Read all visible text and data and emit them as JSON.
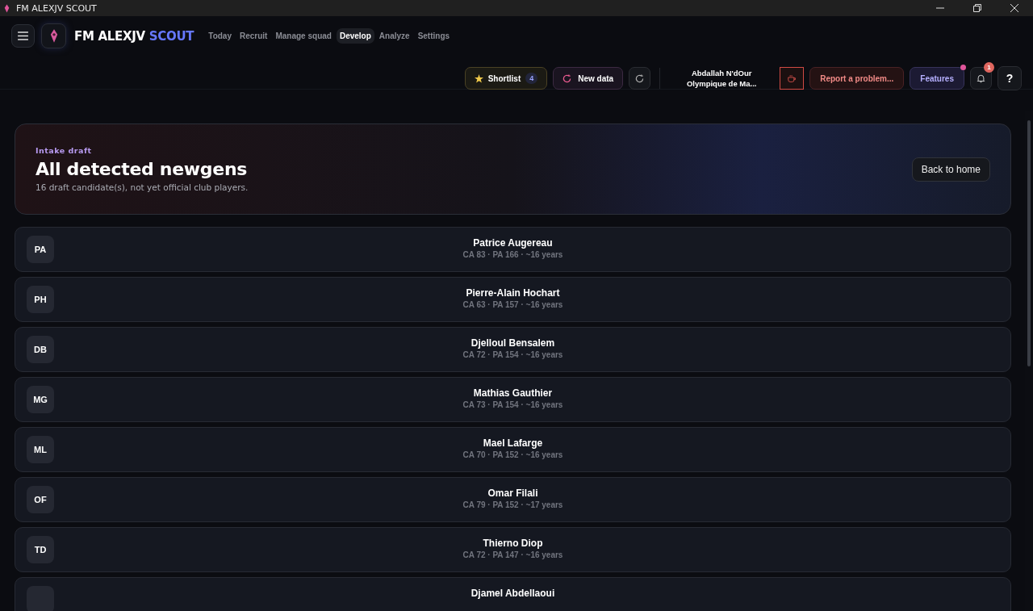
{
  "window": {
    "title": "FM ALEXJV SCOUT"
  },
  "brand": {
    "name": "FM ALEXJV",
    "accent": "SCOUT"
  },
  "nav": [
    {
      "label": "Today",
      "selected": false
    },
    {
      "label": "Recruit",
      "selected": false
    },
    {
      "label": "Manage squad",
      "selected": false
    },
    {
      "label": "Develop",
      "selected": true
    },
    {
      "label": "Analyze",
      "selected": false
    },
    {
      "label": "Settings",
      "selected": false
    }
  ],
  "toolbar": {
    "shortlist": {
      "label": "Shortlist",
      "count": "4"
    },
    "new_data": "New data",
    "manager": {
      "name": "Abdallah N'dOur",
      "club": "Olympique de Ma..."
    },
    "report": "Report a problem...",
    "features": {
      "label": "Features",
      "new_dot": true
    },
    "notifications": {
      "count": "1"
    },
    "help": "?"
  },
  "hero": {
    "eyebrow": "Intake draft",
    "title": "All detected newgens",
    "subtitle": "16 draft candidate(s), not yet official club players.",
    "button": "Back to home"
  },
  "players": [
    {
      "initials": "PA",
      "name": "Patrice Augereau",
      "meta": "CA 83 · PA 166 · ~16 years"
    },
    {
      "initials": "PH",
      "name": "Pierre-Alain Hochart",
      "meta": "CA 63 · PA 157 · ~16 years"
    },
    {
      "initials": "DB",
      "name": "Djelloul Bensalem",
      "meta": "CA 72 · PA 154 · ~16 years"
    },
    {
      "initials": "MG",
      "name": "Mathias Gauthier",
      "meta": "CA 73 · PA 154 · ~16 years"
    },
    {
      "initials": "ML",
      "name": "Mael Lafarge",
      "meta": "CA 70 · PA 152 · ~16 years"
    },
    {
      "initials": "OF",
      "name": "Omar Filali",
      "meta": "CA 79 · PA 152 · ~17 years"
    },
    {
      "initials": "TD",
      "name": "Thierno Diop",
      "meta": "CA 72 · PA 147 · ~16 years"
    },
    {
      "name": "Djamel Abdellaoui"
    }
  ]
}
